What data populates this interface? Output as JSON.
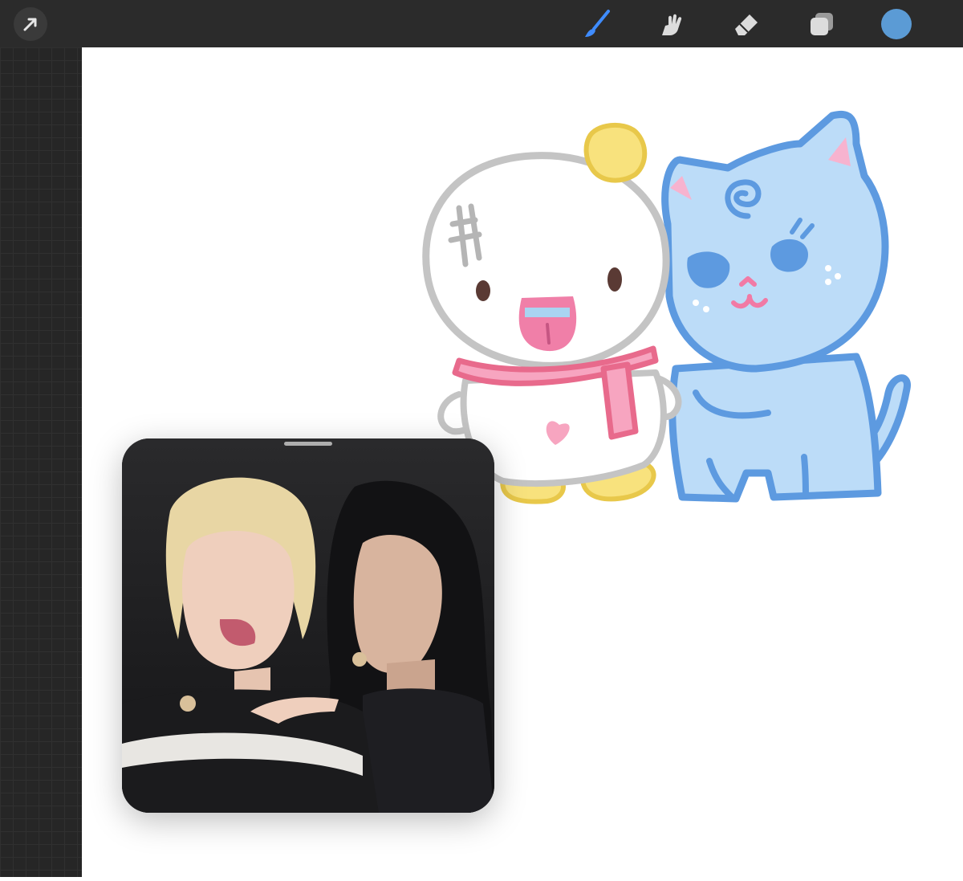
{
  "app": {
    "toolbar": {
      "left": [
        {
          "icon": "arrow-icon"
        }
      ],
      "right": [
        {
          "icon": "brush-icon",
          "active": true,
          "color": "#3f8cff"
        },
        {
          "icon": "smudge-icon"
        },
        {
          "icon": "eraser-icon"
        },
        {
          "icon": "layers-icon"
        },
        {
          "icon": "color-swatch",
          "color": "#5b9bd5"
        }
      ]
    },
    "canvas": {
      "background": "#ffffff",
      "illustration": [
        "snowman-character",
        "blue-cat-character"
      ]
    },
    "picture_in_picture": {
      "content": "photo-of-two-people"
    }
  }
}
